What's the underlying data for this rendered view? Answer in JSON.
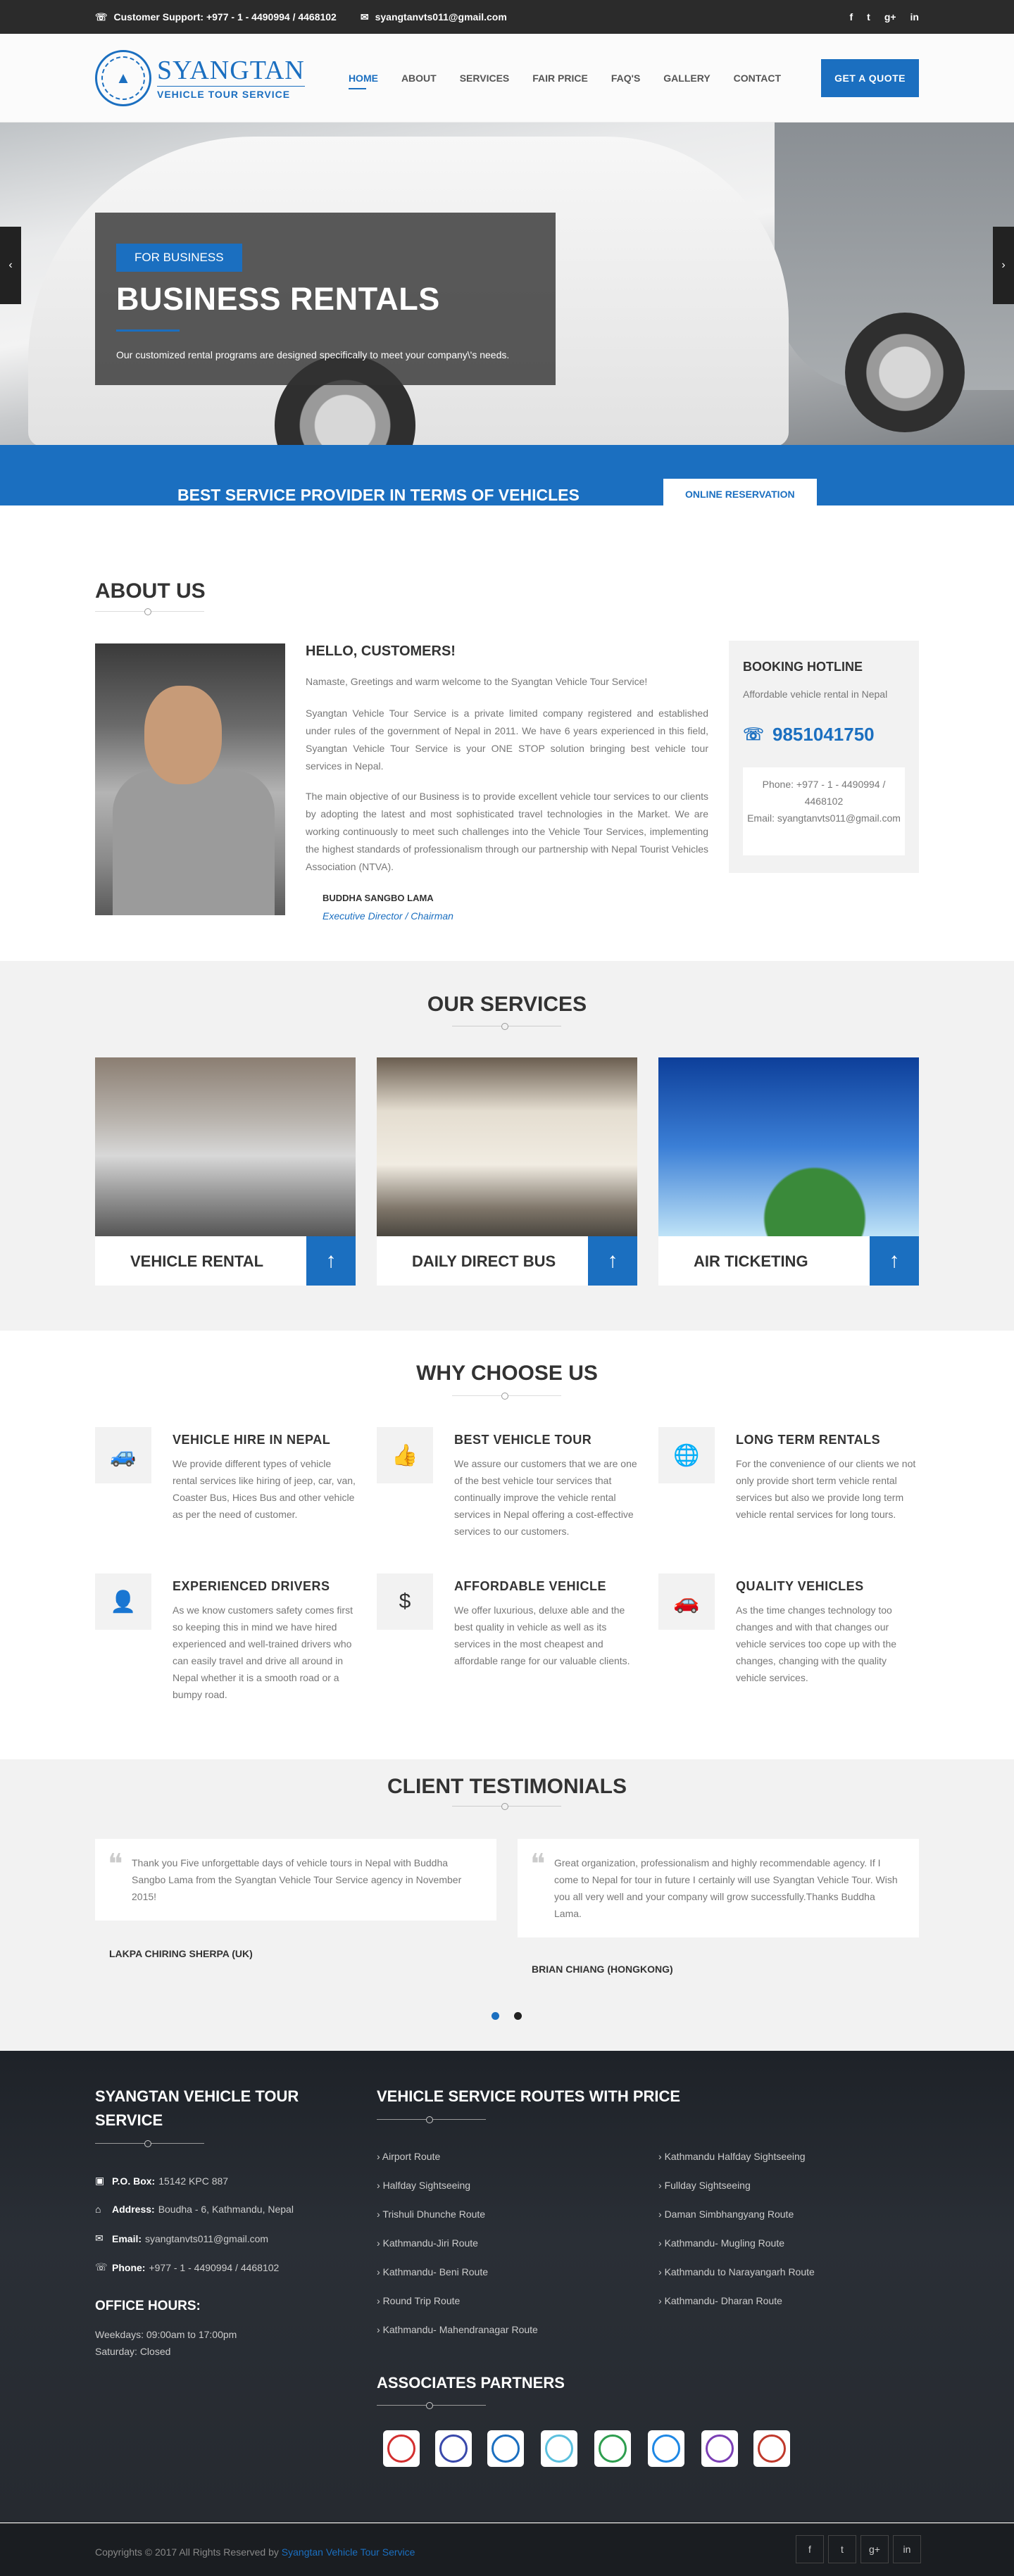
{
  "topbar": {
    "support_label": "Customer Support:",
    "support_value": "+977 - 1 - 4490994 / 4468102",
    "email": "syangtanvts011@gmail.com",
    "social": [
      "f",
      "t",
      "g+",
      "in"
    ]
  },
  "header": {
    "logo_title": "SYANGTAN",
    "logo_sub": "VEHICLE TOUR SERVICE",
    "nav": [
      "HOME",
      "ABOUT",
      "SERVICES",
      "FAIR PRICE",
      "FAQ'S",
      "GALLERY",
      "CONTACT"
    ],
    "quote_button": "GET A QUOTE"
  },
  "hero": {
    "tag": "FOR BUSINESS",
    "title": "BUSINESS RENTALS",
    "subtitle": "Our customized rental programs are designed specifically to meet your company\\'s needs.",
    "prev": "‹",
    "next": "›"
  },
  "banner": {
    "text": "BEST SERVICE PROVIDER IN TERMS OF VEHICLES",
    "button": "ONLINE RESERVATION"
  },
  "about": {
    "title": "ABOUT US",
    "hello": "HELLO, CUSTOMERS!",
    "p1": "Namaste, Greetings and warm welcome to the Syangtan Vehicle Tour Service!",
    "p2": "Syangtan Vehicle Tour Service is a private limited company registered and established under rules of the government of Nepal in 2011. We have 6 years experienced in this field, Syangtan Vehicle Tour Service is your ONE STOP solution bringing best vehicle tour services in Nepal.",
    "p3": "The main objective of our Business is to provide excellent vehicle tour services to our clients by adopting the latest and most sophisticated travel technologies in the Market. We are working continuously to meet such challenges into the Vehicle Tour Services, implementing the highest standards of professionalism through our partnership with Nepal Tourist Vehicles Association (NTVA).",
    "name": "BUDDHA SANGBO LAMA",
    "role": "Executive Director / Chairman",
    "hotline": {
      "title": "BOOKING HOTLINE",
      "sub": "Affordable vehicle rental in Nepal",
      "phone": "9851041750",
      "phone_line1": "Phone: +977 - 1 - 4490994 /",
      "phone_line2": "4468102",
      "email": "Email: syangtanvts011@gmail.com"
    }
  },
  "services": {
    "title": "OUR SERVICES",
    "items": [
      {
        "label": "VEHICLE RENTAL"
      },
      {
        "label": "DAILY DIRECT BUS"
      },
      {
        "label": "AIR TICKETING"
      }
    ]
  },
  "why": {
    "title": "WHY CHOOSE US",
    "items": [
      {
        "title": "VEHICLE HIRE IN NEPAL",
        "desc": "We provide different types of vehicle rental services like hiring of jeep, car, van, Coaster Bus, Hices Bus and other vehicle as per the need of customer.",
        "icon": "car-icon"
      },
      {
        "title": "BEST VEHICLE TOUR",
        "desc": "We assure our customers that we are one of the best vehicle tour services that continually improve the vehicle rental services in Nepal offering a cost-effective services to our customers.",
        "icon": "thumbs-up-icon"
      },
      {
        "title": "LONG TERM RENTALS",
        "desc": "For the convenience of our clients we not only provide short term vehicle rental services but also we provide long term vehicle rental services for long tours.",
        "icon": "globe-icon"
      },
      {
        "title": "EXPERIENCED DRIVERS",
        "desc": "As we know customers safety comes first so keeping this in mind we have hired experienced and well-trained drivers who can easily travel and drive all around in Nepal whether it is a smooth road or a bumpy road.",
        "icon": "driver-icon"
      },
      {
        "title": "AFFORDABLE VEHICLE",
        "desc": "We offer luxurious, deluxe able and the best quality in vehicle as well as its services in the most cheapest and affordable range for our valuable clients.",
        "icon": "dollar-icon"
      },
      {
        "title": "QUALITY VEHICLES",
        "desc": "As the time changes technology too changes and with that changes our vehicle services too cope up with the changes, changing with the quality vehicle services.",
        "icon": "car-icon"
      }
    ]
  },
  "testimonials": {
    "title": "CLIENT TESTIMONIALS",
    "items": [
      {
        "text": "Thank you Five unforgettable days of vehicle tours in Nepal with Buddha Sangbo Lama from the Syangtan Vehicle Tour Service agency in November 2015!",
        "name": "LAKPA CHIRING SHERPA (UK)"
      },
      {
        "text": "Great organization, professionalism and highly recommendable agency. If I come to Nepal for tour in future I certainly will use Syangtan Vehicle Tour. Wish you all very well and your company will grow successfully.Thanks Buddha Lama.",
        "name": "BRIAN CHIANG (HONGKONG)"
      }
    ]
  },
  "footer": {
    "company_title_1": "SYANGTAN VEHICLE TOUR",
    "company_title_2": "SERVICE",
    "pobox_label": "P.O. Box:",
    "pobox": "15142 KPC 887",
    "address_label": "Address:",
    "address": "Boudha - 6, Kathmandu, Nepal",
    "email_label": "Email:",
    "email": "syangtanvts011@gmail.com",
    "phone_label": "Phone:",
    "phone": "+977 - 1 - 4490994 / 4468102",
    "office_title": "OFFICE HOURS:",
    "weekdays": "Weekdays: 09:00am to 17:00pm",
    "saturday": "Saturday: Closed",
    "routes_title": "VEHICLE SERVICE ROUTES WITH PRICE",
    "routes_left": [
      "Airport Route",
      "Halfday Sightseeing",
      "Trishuli Dhunche Route",
      "Kathmandu-Jiri Route",
      "Kathmandu- Beni Route",
      "Round Trip Route",
      "Kathmandu- Mahendranagar Route"
    ],
    "routes_right": [
      "Kathmandu Halfday Sightseeing",
      "Fullday Sightseeing",
      "Daman Simbhangyang Route",
      "Kathmandu- Mugling Route",
      "Kathmandu to Narayangarh Route",
      "Kathmandu- Dharan Route"
    ],
    "partners_title": "ASSOCIATES PARTNERS",
    "copyright": "Copyrights © 2017 All Rights Reserved by",
    "copyright_link": "Syangtan Vehicle Tour Service",
    "social": [
      "f",
      "t",
      "g+",
      "in"
    ]
  },
  "colors": {
    "accent": "#1b6fc0",
    "dark": "#2b2b2b"
  }
}
